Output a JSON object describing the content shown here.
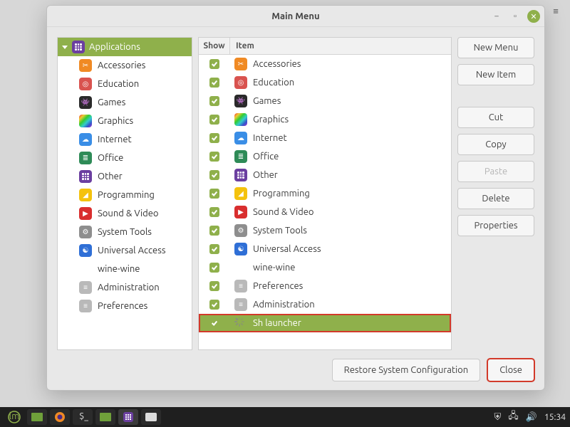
{
  "window": {
    "title": "Main Menu"
  },
  "columns": {
    "show": "Show",
    "item": "Item"
  },
  "sidebar": {
    "header": "Applications",
    "items": [
      {
        "label": "Accessories",
        "icon": "ic-orange",
        "glyph": "✂"
      },
      {
        "label": "Education",
        "icon": "ic-red",
        "glyph": "◎"
      },
      {
        "label": "Games",
        "icon": "ic-dark",
        "glyph": "👾"
      },
      {
        "label": "Graphics",
        "icon": "ic-rainbow",
        "glyph": ""
      },
      {
        "label": "Internet",
        "icon": "ic-blue",
        "glyph": "☁"
      },
      {
        "label": "Office",
        "icon": "ic-green",
        "glyph": "≣"
      },
      {
        "label": "Other",
        "icon": "ic-purple",
        "glyph": ""
      },
      {
        "label": "Programming",
        "icon": "ic-yellow",
        "glyph": "◢"
      },
      {
        "label": "Sound & Video",
        "icon": "ic-play",
        "glyph": "▶"
      },
      {
        "label": "System Tools",
        "icon": "ic-gear",
        "glyph": "⚙"
      },
      {
        "label": "Universal Access",
        "icon": "ic-access",
        "glyph": "☯"
      },
      {
        "label": "wine-wine",
        "icon": "ic-none",
        "glyph": ""
      },
      {
        "label": "Administration",
        "icon": "ic-cfg",
        "glyph": "≡"
      },
      {
        "label": "Preferences",
        "icon": "ic-cfg",
        "glyph": "≡"
      }
    ]
  },
  "list": {
    "items": [
      {
        "label": "Accessories",
        "icon": "ic-orange",
        "glyph": "✂"
      },
      {
        "label": "Education",
        "icon": "ic-red",
        "glyph": "◎"
      },
      {
        "label": "Games",
        "icon": "ic-dark",
        "glyph": "👾"
      },
      {
        "label": "Graphics",
        "icon": "ic-rainbow",
        "glyph": ""
      },
      {
        "label": "Internet",
        "icon": "ic-blue",
        "glyph": "☁"
      },
      {
        "label": "Office",
        "icon": "ic-green",
        "glyph": "≣"
      },
      {
        "label": "Other",
        "icon": "ic-purple",
        "glyph": ""
      },
      {
        "label": "Programming",
        "icon": "ic-yellow",
        "glyph": "◢"
      },
      {
        "label": "Sound & Video",
        "icon": "ic-play",
        "glyph": "▶"
      },
      {
        "label": "System Tools",
        "icon": "ic-gear",
        "glyph": "⚙"
      },
      {
        "label": "Universal Access",
        "icon": "ic-access",
        "glyph": "☯"
      },
      {
        "label": "wine-wine",
        "icon": "ic-none",
        "glyph": ""
      },
      {
        "label": "Preferences",
        "icon": "ic-cfg",
        "glyph": "≡"
      },
      {
        "label": "Administration",
        "icon": "ic-cfg",
        "glyph": "≡"
      },
      {
        "label": "Sh launcher",
        "icon": "spinner",
        "glyph": "",
        "selected": true,
        "highlight": true
      }
    ]
  },
  "buttons": {
    "new_menu": "New Menu",
    "new_item": "New Item",
    "cut": "Cut",
    "copy": "Copy",
    "paste": "Paste",
    "delete": "Delete",
    "properties": "Properties"
  },
  "footer": {
    "restore": "Restore System Configuration",
    "close": "Close"
  },
  "tray": {
    "time": "15:34"
  }
}
